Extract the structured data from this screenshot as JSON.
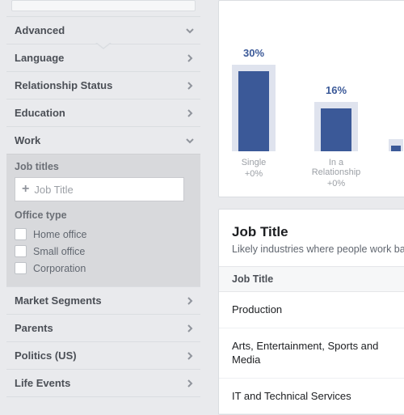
{
  "sidebar": {
    "advanced": "Advanced",
    "language": "Language",
    "relationship_status": "Relationship Status",
    "education": "Education",
    "work": "Work",
    "job_titles_label": "Job titles",
    "job_title_placeholder": "Job Title",
    "office_type_label": "Office type",
    "office_options": [
      {
        "label": "Home office"
      },
      {
        "label": "Small office"
      },
      {
        "label": "Corporation"
      }
    ],
    "market_segments": "Market Segments",
    "parents": "Parents",
    "politics": "Politics (US)",
    "life_events": "Life Events"
  },
  "chart_data": {
    "type": "bar",
    "categories": [
      "Single",
      "In a Relationship",
      ""
    ],
    "values": [
      30,
      16,
      2
    ],
    "deltas": [
      "+0%",
      "+0%",
      ""
    ],
    "ylim": [
      0,
      40
    ],
    "series_color": "#3b5998"
  },
  "job_title_card": {
    "title": "Job Title",
    "subtitle": "Likely industries where people work ba",
    "col_header": "Job Title",
    "rows": [
      "Production",
      "Arts, Entertainment, Sports and Media",
      "IT and Technical Services"
    ]
  }
}
